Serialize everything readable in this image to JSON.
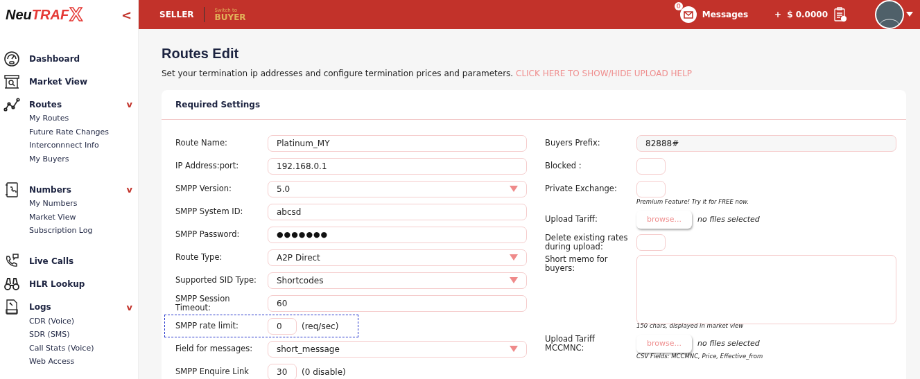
{
  "brand": {
    "logo_part1": "Neu",
    "logo_part2": "TRAF",
    "logo_mark": "X",
    "collapse_glyph": "<"
  },
  "header": {
    "seller": "SELLER",
    "switch_hint": "Switch to",
    "buyer": "BUYER",
    "messages_count": "0",
    "messages": "Messages",
    "balance_sign": "+",
    "balance": "$ 0.0000"
  },
  "sidebar": {
    "items": [
      {
        "kind": "gauge",
        "label": "Dashboard"
      },
      {
        "kind": "store",
        "label": "Market View"
      },
      {
        "kind": "chart",
        "label": "Routes",
        "toggle": "v",
        "expanded": true,
        "children": [
          {
            "label": "My Routes"
          },
          {
            "label": "Future Rate Changes"
          },
          {
            "label": "Interconnnect Info"
          },
          {
            "label": "My Buyers"
          }
        ]
      },
      {
        "kind": "book",
        "label": "Numbers",
        "toggle": "v",
        "expanded": true,
        "children": [
          {
            "label": "My Numbers"
          },
          {
            "label": "Market View"
          },
          {
            "label": "Subscription Log"
          }
        ]
      },
      {
        "kind": "phone",
        "label": "Live Calls"
      },
      {
        "kind": "binoculars",
        "label": "HLR Lookup"
      },
      {
        "kind": "log",
        "label": "Logs",
        "toggle": "v",
        "expanded": true,
        "children": [
          {
            "label": "CDR (Voice)"
          },
          {
            "label": "SDR (SMS)"
          },
          {
            "label": "Call Stats (Voice)"
          },
          {
            "label": "Web Access"
          }
        ]
      }
    ]
  },
  "page": {
    "title": "Routes Edit",
    "subtitle": "Set your termination ip addresses and configure termination prices and parameters.",
    "help_link": "CLICK HERE TO SHOW/HIDE UPLOAD HELP"
  },
  "card": {
    "title": "Required Settings",
    "left_fields": [
      {
        "kind": "text",
        "label": "Route Name:",
        "value": "Platinum_MY",
        "selected": false
      },
      {
        "kind": "text",
        "label": "IP Address:port:",
        "value": "192.168.0.1",
        "selected": false
      },
      {
        "kind": "select",
        "label": "SMPP Version:",
        "value": "5.0",
        "selected": false
      },
      {
        "kind": "text",
        "label": "SMPP System ID:",
        "value": "abcsd",
        "selected": false
      },
      {
        "kind": "password",
        "label": "SMPP Password:",
        "value": "●●●●●●●",
        "selected": false
      },
      {
        "kind": "select",
        "label": "Route Type:",
        "value": "A2P Direct",
        "selected": false
      },
      {
        "kind": "select",
        "label": "Supported SID Type:",
        "value": "Shortcodes",
        "selected": false
      },
      {
        "kind": "text",
        "label": "SMPP Session Timeout:",
        "value": "60",
        "selected": false
      },
      {
        "kind": "small",
        "label": "SMPP rate limit:",
        "value": "0",
        "suffix": "(req/sec)",
        "selected": true
      },
      {
        "kind": "select",
        "label": "Field for messages:",
        "value": "short_message",
        "selected": false
      },
      {
        "kind": "small",
        "label": "SMPP Enquire Link",
        "value": "30",
        "suffix": "(0 disable)",
        "selected": false
      }
    ],
    "right_fields": [
      {
        "kind": "readonly",
        "label": "Buyers Prefix:",
        "value": "82888#"
      },
      {
        "kind": "box",
        "label": "Blocked :"
      },
      {
        "kind": "box",
        "label": "Private Exchange:",
        "note": "Premium Feature! Try it for FREE now."
      },
      {
        "kind": "file",
        "label": "Upload Tariff:",
        "button": "browse...",
        "status": "no files selected"
      },
      {
        "kind": "box",
        "label": "Delete existing rates during upload:"
      },
      {
        "kind": "textarea",
        "label": "Short memo for buyers:",
        "note": "150 chars, displayed in market view"
      },
      {
        "kind": "file",
        "label": "Upload Tariff MCCMNC:",
        "button": "browse...",
        "status": "no files selected",
        "note": "CSV Fields: MCCMNC, Price, Effective_from"
      }
    ]
  }
}
